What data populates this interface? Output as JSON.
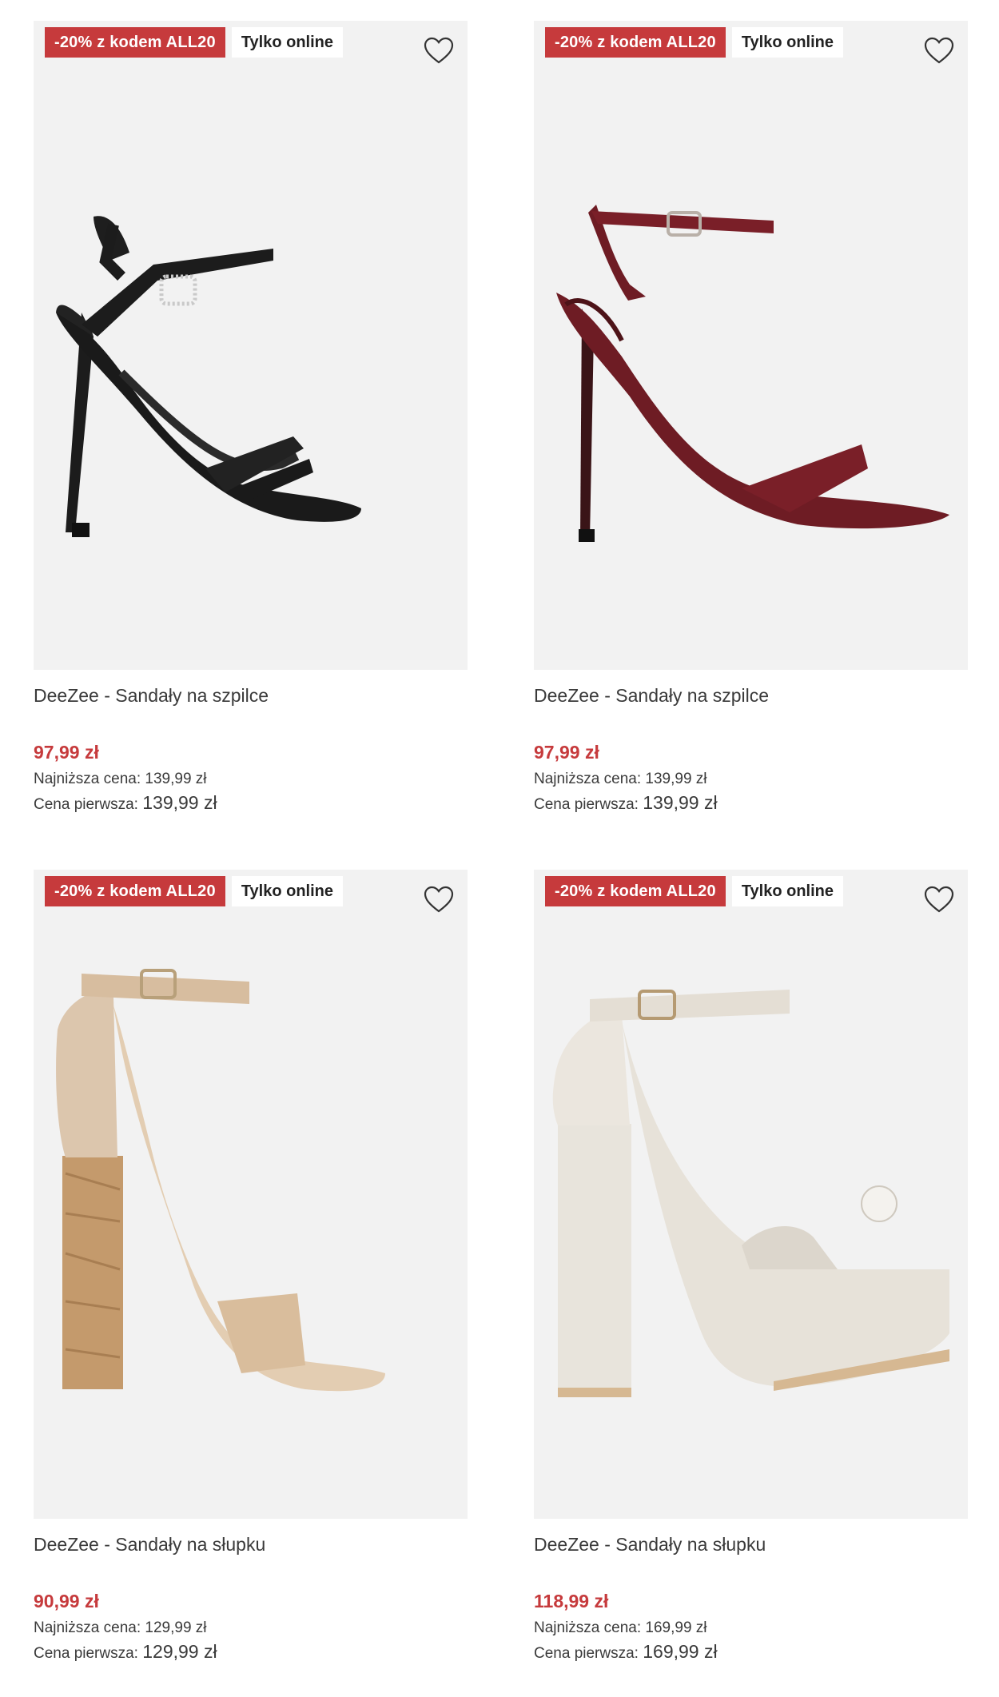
{
  "colors": {
    "promo": "#c63a3c",
    "photo_bg": "#f2f2f2",
    "price": "#c63a3c"
  },
  "products": [
    {
      "promo_badge": "-20% z kodem ALL20",
      "online_badge": "Tylko online",
      "name": "DeeZee - Sandały na szpilce",
      "price": "97,99 zł",
      "lowest_label": "Najniższa cena:",
      "lowest_value": "139,99 zł",
      "first_label": "Cena pierwsza:",
      "first_value": "139,99 zł",
      "image": "black strappy stiletto sandal",
      "favorite_icon": "heart-icon"
    },
    {
      "promo_badge": "-20% z kodem ALL20",
      "online_badge": "Tylko online",
      "name": "DeeZee - Sandały na szpilce",
      "price": "97,99 zł",
      "lowest_label": "Najniższa cena:",
      "lowest_value": "139,99 zł",
      "first_label": "Cena pierwsza:",
      "first_value": "139,99 zł",
      "image": "burgundy snakeskin stiletto sandal",
      "favorite_icon": "heart-icon"
    },
    {
      "promo_badge": "-20% z kodem ALL20",
      "online_badge": "Tylko online",
      "name": "DeeZee - Sandały na słupku",
      "price": "90,99 zł",
      "lowest_label": "Najniższa cena:",
      "lowest_value": "129,99 zł",
      "first_label": "Cena pierwsza:",
      "first_value": "129,99 zł",
      "image": "beige suede block heel sandal with cork heel",
      "favorite_icon": "heart-icon"
    },
    {
      "promo_badge": "-20% z kodem ALL20",
      "online_badge": "Tylko online",
      "name": "DeeZee - Sandały na słupku",
      "price": "118,99 zł",
      "lowest_label": "Najniższa cena:",
      "lowest_value": "169,99 zł",
      "first_label": "Cena pierwsza:",
      "first_value": "169,99 zł",
      "image": "cream platform block heel sandal with pearl",
      "favorite_icon": "heart-icon"
    }
  ]
}
